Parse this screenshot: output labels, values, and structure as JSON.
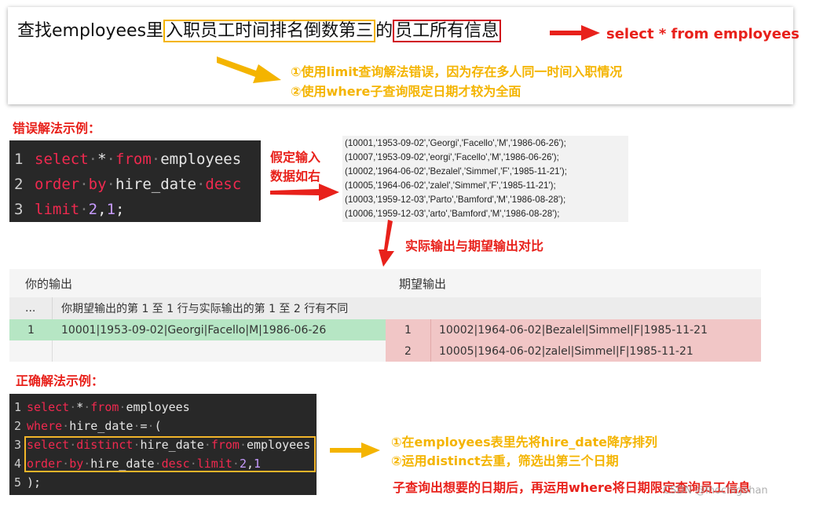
{
  "question": {
    "prefix": "查找employees里",
    "hl1": "入职员工时间排名倒数第三",
    "mid": "的",
    "hl2": "员工所有信息",
    "select_stmt": "select * from employees",
    "note1": "①使用limit查询解法错误，因为存在多人同一时间入职情况",
    "note2": "②使用where子查询限定日期才较为全面"
  },
  "wrong": {
    "title": "错误解法示例：",
    "lines": [
      {
        "n": "1",
        "tokens": [
          {
            "t": "select",
            "c": "kw"
          },
          {
            "t": "·",
            "c": "dot"
          },
          {
            "t": "*",
            "c": "id"
          },
          {
            "t": "·",
            "c": "dot"
          },
          {
            "t": "from",
            "c": "kw"
          },
          {
            "t": "·",
            "c": "dot"
          },
          {
            "t": "employees",
            "c": "id"
          }
        ]
      },
      {
        "n": "2",
        "tokens": [
          {
            "t": "order",
            "c": "kw"
          },
          {
            "t": "·",
            "c": "dot"
          },
          {
            "t": "by",
            "c": "kw"
          },
          {
            "t": "·",
            "c": "dot"
          },
          {
            "t": "hire_date",
            "c": "id"
          },
          {
            "t": "·",
            "c": "dot"
          },
          {
            "t": "desc",
            "c": "kw"
          }
        ]
      },
      {
        "n": "3",
        "tokens": [
          {
            "t": "limit",
            "c": "kw"
          },
          {
            "t": "·",
            "c": "dot"
          },
          {
            "t": "2",
            "c": "num"
          },
          {
            "t": ",",
            "c": "id"
          },
          {
            "t": "1",
            "c": "num"
          },
          {
            "t": ";",
            "c": "id"
          }
        ]
      }
    ],
    "assume_label_1": "假定输入",
    "assume_label_2": "数据如右",
    "input_rows": [
      "(10001,'1953-09-02','Georgi','Facello','M','1986-06-26');",
      "(10007,'1953-09-02','eorgi','Facello','M','1986-06-26');",
      "(10002,'1964-06-02','Bezalel','Simmel','F','1985-11-21');",
      "(10005,'1964-06-02','zalel','Simmel','F','1985-11-21');",
      "(10003,'1959-12-03','Parto','Bamford','M','1986-08-28');",
      "(10006,'1959-12-03','arto','Bamford','M','1986-08-28');"
    ],
    "compare_label": "实际输出与期望输出对比"
  },
  "result": {
    "your_output": "你的输出",
    "expected_output": "期望输出",
    "ellipsis": "...",
    "diff_msg": "你期望输出的第 1 至 1 行与实际输出的第 1 至 2 行有不同",
    "actual_rows": [
      {
        "n": "1",
        "v": "10001|1953-09-02|Georgi|Facello|M|1986-06-26"
      }
    ],
    "expected_rows": [
      {
        "n": "1",
        "v": "10002|1964-06-02|Bezalel|Simmel|F|1985-11-21"
      },
      {
        "n": "2",
        "v": "10005|1964-06-02|zalel|Simmel|F|1985-11-21"
      }
    ]
  },
  "correct": {
    "title": "正确解法示例：",
    "lines": [
      {
        "n": "1",
        "tokens": [
          {
            "t": "select",
            "c": "kw"
          },
          {
            "t": "·",
            "c": "dot"
          },
          {
            "t": "*",
            "c": "id"
          },
          {
            "t": "·",
            "c": "dot"
          },
          {
            "t": "from",
            "c": "kw"
          },
          {
            "t": "·",
            "c": "dot"
          },
          {
            "t": "employees",
            "c": "id"
          }
        ]
      },
      {
        "n": "2",
        "tokens": [
          {
            "t": "where",
            "c": "kw"
          },
          {
            "t": "·",
            "c": "dot"
          },
          {
            "t": "hire_date",
            "c": "id"
          },
          {
            "t": "·",
            "c": "dot"
          },
          {
            "t": "=",
            "c": "id"
          },
          {
            "t": "·",
            "c": "dot"
          },
          {
            "t": "(",
            "c": "id"
          }
        ]
      },
      {
        "n": "3",
        "tokens": [
          {
            "t": "select",
            "c": "kw"
          },
          {
            "t": "·",
            "c": "dot"
          },
          {
            "t": "distinct",
            "c": "kw"
          },
          {
            "t": "·",
            "c": "dot"
          },
          {
            "t": "hire_date",
            "c": "id"
          },
          {
            "t": "·",
            "c": "dot"
          },
          {
            "t": "from",
            "c": "kw"
          },
          {
            "t": "·",
            "c": "dot"
          },
          {
            "t": "employees",
            "c": "id"
          }
        ]
      },
      {
        "n": "4",
        "tokens": [
          {
            "t": "order",
            "c": "kw"
          },
          {
            "t": "·",
            "c": "dot"
          },
          {
            "t": "by",
            "c": "kw"
          },
          {
            "t": "·",
            "c": "dot"
          },
          {
            "t": "hire_date",
            "c": "id"
          },
          {
            "t": "·",
            "c": "dot"
          },
          {
            "t": "desc",
            "c": "kw"
          },
          {
            "t": "·",
            "c": "dot"
          },
          {
            "t": "limit",
            "c": "kw"
          },
          {
            "t": "·",
            "c": "dot"
          },
          {
            "t": "2",
            "c": "num"
          },
          {
            "t": ",",
            "c": "id"
          },
          {
            "t": "1",
            "c": "num"
          }
        ]
      },
      {
        "n": "5",
        "tokens": [
          {
            "t": ");",
            "c": "id"
          }
        ]
      }
    ],
    "note1": "①在employees表里先将hire_date降序排列",
    "note2": "②运用distinct去重，筛选出第三个日期",
    "summary": "子查询出想要的日期后，再运用where将日期限定查询员工信息"
  },
  "watermark": "CSDN @lhochigohan",
  "colors": {
    "red": "#e8211b",
    "yellow": "#f4b400",
    "code_bg": "#282828",
    "actual_bg": "#b6e6c4",
    "expected_bg": "#f1c6c6"
  }
}
